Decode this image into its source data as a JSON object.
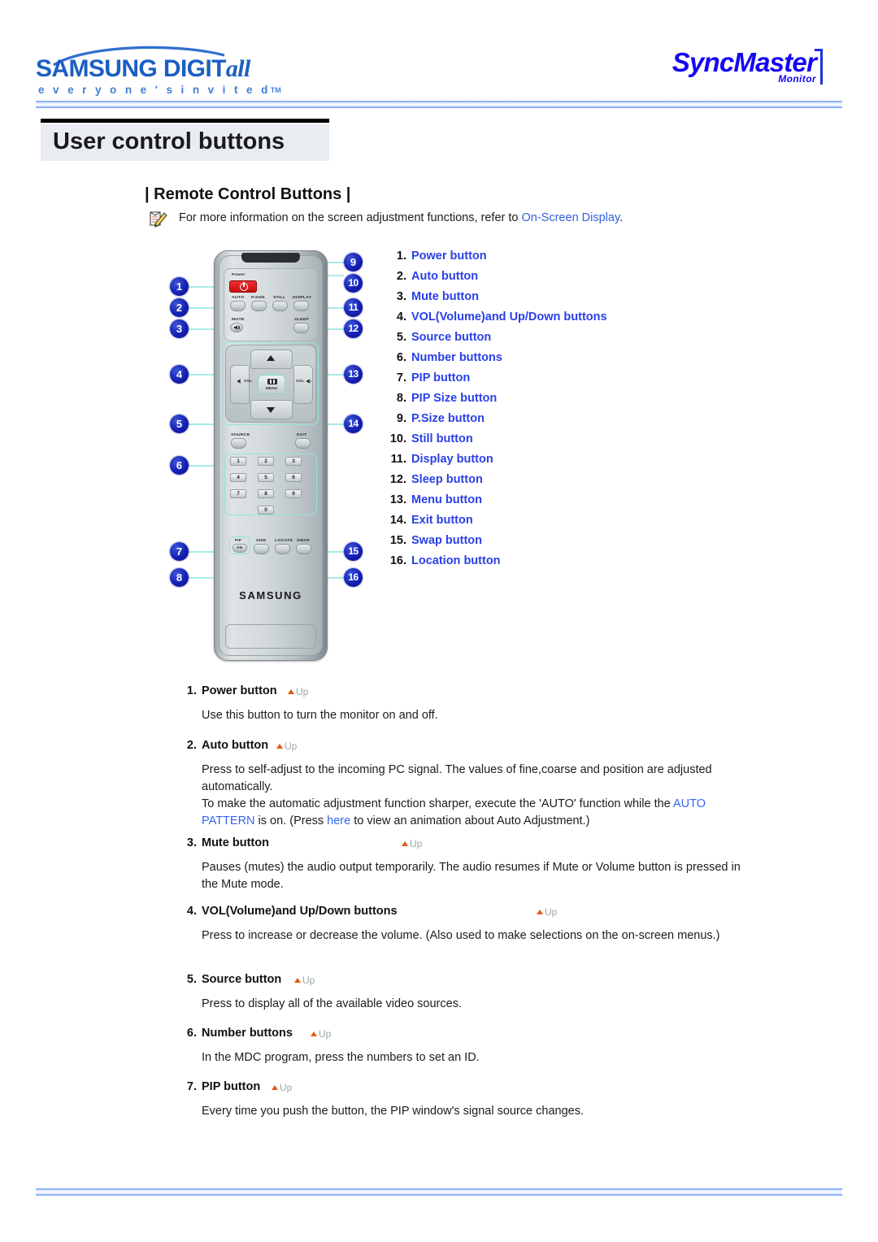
{
  "header": {
    "samsung_logo_main": "SAMSUNG DIGIT",
    "samsung_logo_italic": "all",
    "samsung_logo_sub": "e v e r y o n e ' s   i n v i t e d",
    "samsung_logo_tm": "TM",
    "syncmaster_main": "SyncMaster",
    "syncmaster_sub": "Monitor"
  },
  "page_title": "User control buttons",
  "section": {
    "heading": "| Remote Control Buttons |",
    "note_prefix": "For more information on the screen adjustment functions, refer to ",
    "note_link": "On-Screen Display",
    "note_suffix": "."
  },
  "remote": {
    "brand": "SAMSUNG",
    "labels": {
      "power": "Power",
      "auto": "AUTO",
      "psize": "P.SIZE",
      "still": "STILL",
      "display": "DISPLAY",
      "mute": "MUTE",
      "sleep": "SLEEP",
      "vol_left": "VOL",
      "vol_right": "VOL",
      "menu": "MENU",
      "source": "SOURCE",
      "exit": "EXIT",
      "pip": "PIP",
      "pip_on": "ON",
      "size": "SIZE",
      "locate": "LOCATE",
      "swap": "SWAP"
    },
    "keys": [
      "1",
      "2",
      "3",
      "4",
      "5",
      "6",
      "7",
      "8",
      "9",
      "0"
    ],
    "callouts_left": [
      "1",
      "2",
      "3",
      "4",
      "5",
      "6",
      "7",
      "8"
    ],
    "callouts_right": [
      "9",
      "10",
      "11",
      "12",
      "13",
      "14",
      "15",
      "16"
    ]
  },
  "button_list": [
    {
      "n": "1.",
      "label": "Power button"
    },
    {
      "n": "2.",
      "label": "Auto button"
    },
    {
      "n": "3.",
      "label": "Mute button"
    },
    {
      "n": "4.",
      "label": "VOL(Volume)and Up/Down buttons"
    },
    {
      "n": "5.",
      "label": "Source button"
    },
    {
      "n": "6.",
      "label": "Number buttons"
    },
    {
      "n": "7.",
      "label": "PIP button"
    },
    {
      "n": "8.",
      "label": "PIP Size button"
    },
    {
      "n": "9.",
      "label": "P.Size button"
    },
    {
      "n": "10.",
      "label": "Still button"
    },
    {
      "n": "11.",
      "label": "Display button"
    },
    {
      "n": "12.",
      "label": "Sleep button"
    },
    {
      "n": "13.",
      "label": "Menu button"
    },
    {
      "n": "14.",
      "label": "Exit button"
    },
    {
      "n": "15.",
      "label": "Swap button"
    },
    {
      "n": "16.",
      "label": "Location button"
    }
  ],
  "up_label": "Up",
  "details": [
    {
      "n": "1.",
      "title": "Power button",
      "body": "Use this button to turn the monitor on and off."
    },
    {
      "n": "2.",
      "title": "Auto button",
      "body_p1": "Press to self-adjust to the incoming PC signal. The values of fine,coarse and position are adjusted automatically.",
      "body_p2_a": "To make the automatic adjustment function sharper, execute the 'AUTO' function while the ",
      "body_p2_link1": "AUTO PATTERN",
      "body_p2_b": " is on. (Press ",
      "body_p2_link2": "here",
      "body_p2_c": " to view an animation about Auto Adjustment.)"
    },
    {
      "n": "3.",
      "title": "Mute button",
      "body": "Pauses (mutes) the audio output temporarily. The audio resumes if Mute or  Volume button is pressed in the Mute mode."
    },
    {
      "n": "4.",
      "title": "VOL(Volume)and Up/Down buttons",
      "body": "Press to increase or decrease the volume. (Also used to make selections on the on-screen menus.)"
    },
    {
      "n": "5.",
      "title": "Source button",
      "body": "Press to display all of the available video sources."
    },
    {
      "n": "6.",
      "title": "Number buttons",
      "body": "In the MDC program, press the numbers to set an ID."
    },
    {
      "n": "7.",
      "title": "PIP button",
      "body": "Every time you push the button, the PIP window's signal source changes."
    }
  ],
  "colors": {
    "link_blue": "#2f5fe0",
    "list_blue": "#2a3fe8",
    "badge_blue": "#1520b4",
    "title_band": "#e9edf2",
    "rule_blue": "#7ea6f5",
    "power_red": "#cc0d0d",
    "lead_teal": "#a8ece6",
    "up_triangle": "#e05a12"
  }
}
